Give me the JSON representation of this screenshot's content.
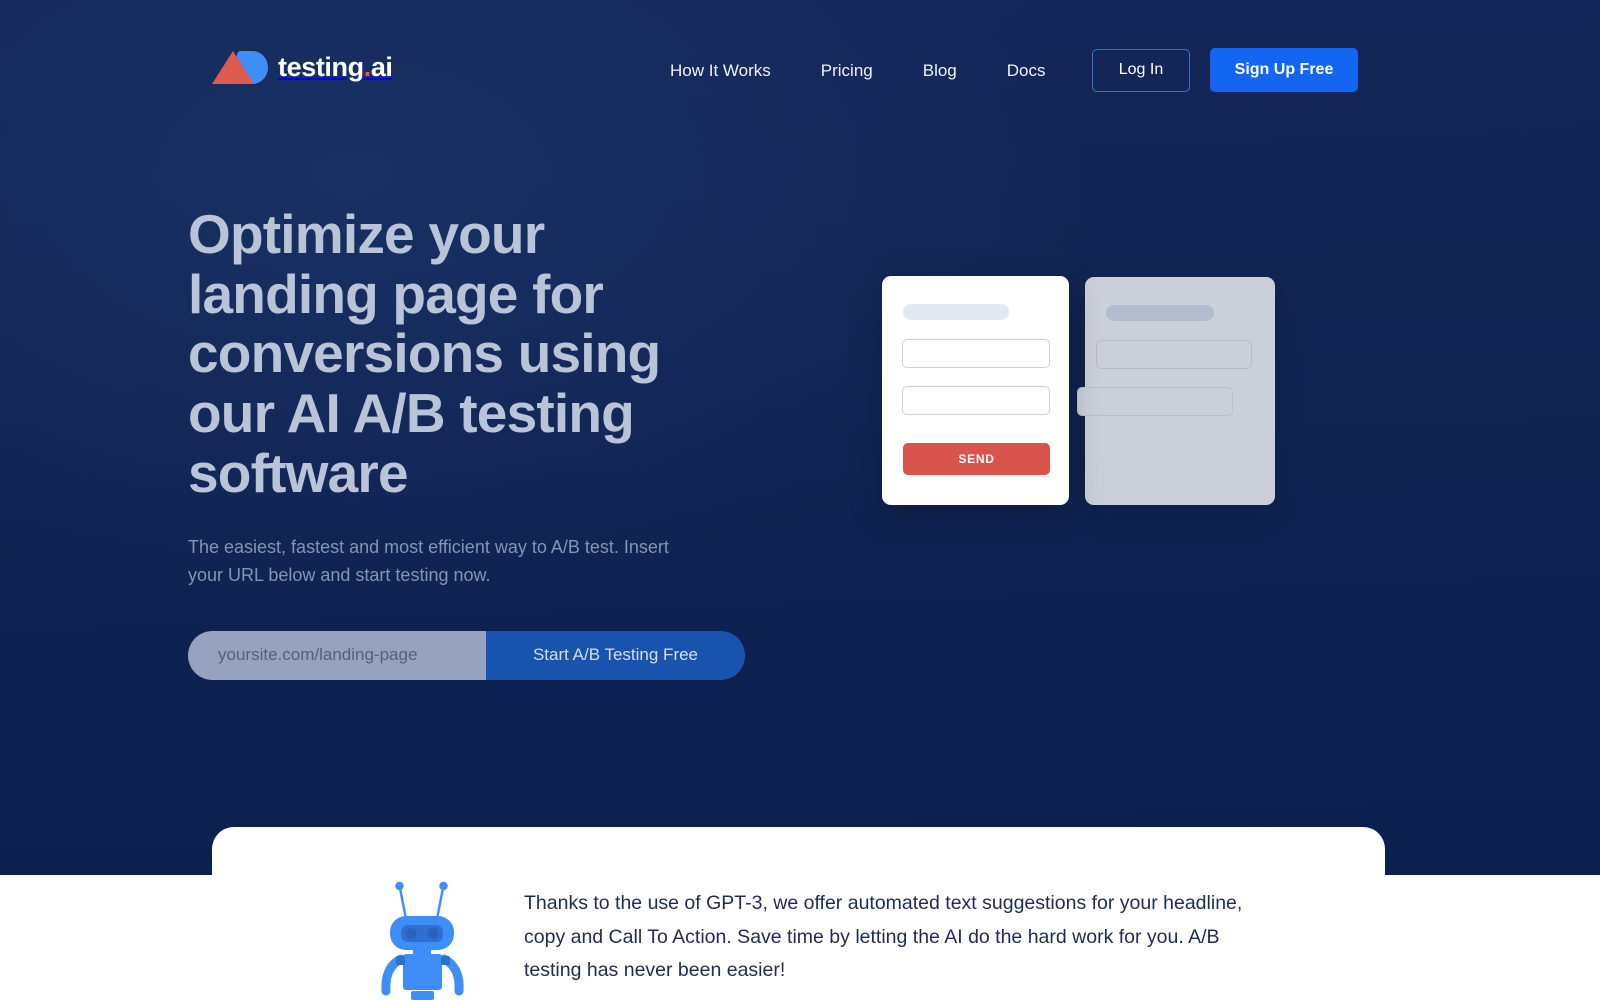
{
  "brand": {
    "name_main": "testing",
    "name_dot": ".",
    "name_suffix": "ai",
    "logo_triangle_color": "#dd5a4e",
    "logo_b_color": "#3d8ef7",
    "accent_blue": "#1366f2",
    "accent_red": "#d9544d",
    "hero_background": "#132553"
  },
  "nav": {
    "items": [
      {
        "label": "How It Works"
      },
      {
        "label": "Pricing"
      },
      {
        "label": "Blog"
      },
      {
        "label": "Docs"
      }
    ],
    "login_label": "Log In",
    "signup_label": "Sign Up Free"
  },
  "hero": {
    "headline": "Optimize your landing page for conversions using our AI A/B testing software",
    "subhead": "The easiest, fastest and most efficient way to A/B test. Insert your URL below and start testing now.",
    "url_placeholder": "yoursite.com/landing-page",
    "url_value": "",
    "cta_label": "Start A/B Testing Free"
  },
  "mockups": {
    "card_a": {
      "send_label": "SEND"
    },
    "card_b": {}
  },
  "gpt_section": {
    "body": "Thanks to the use of GPT-3, we offer automated text suggestions for your headline, copy and Call To Action. Save time by letting the AI do the hard work for you. A/B testing has never been easier!",
    "robot_color": "#3d8ef7",
    "robot_dark_color": "#2f6fd0"
  }
}
